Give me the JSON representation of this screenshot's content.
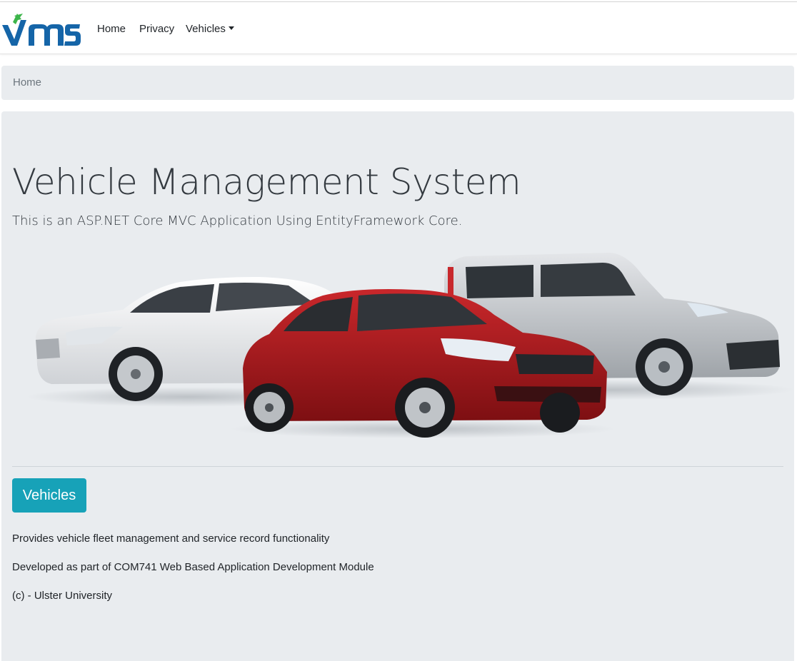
{
  "navbar": {
    "brand": "VMS",
    "links": [
      {
        "label": "Home"
      },
      {
        "label": "Privacy"
      },
      {
        "label": "Vehicles"
      }
    ]
  },
  "breadcrumb": {
    "items": [
      "Home"
    ]
  },
  "hero": {
    "title": "Vehicle Management System",
    "lead": "This is an ASP.NET Core MVC Application Using EntityFramework Core.",
    "button_label": "Vehicles",
    "paragraphs": [
      "Provides vehicle fleet management and service record functionality",
      "Developed as part of COM741 Web Based Application Development Module",
      "(c) - Ulster University"
    ]
  },
  "colors": {
    "brand_blue": "#1565a8",
    "brand_green": "#3cb54a",
    "info_button": "#17a2b8",
    "jumbotron_bg": "#e9ecef"
  }
}
